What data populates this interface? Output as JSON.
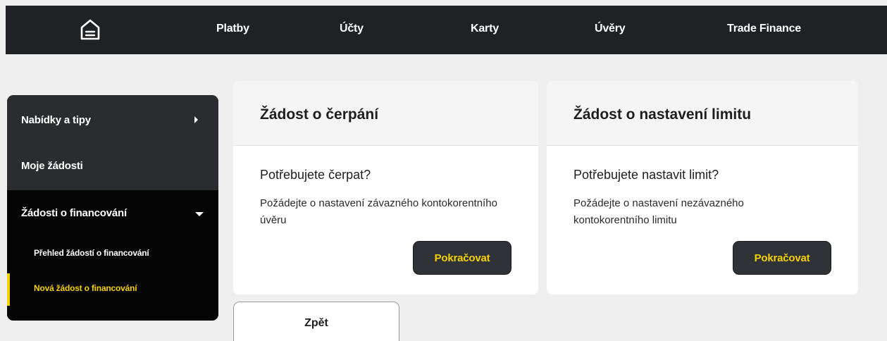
{
  "nav": {
    "home_icon": "home-icon",
    "items": [
      "Platby",
      "Účty",
      "Karty",
      "Úvěry",
      "Trade Finance"
    ]
  },
  "sidebar": {
    "items": [
      {
        "label": "Nabídky a tipy",
        "icon": "chevron-right-icon"
      },
      {
        "label": "Moje žádosti"
      },
      {
        "label": "Žádosti o financování",
        "icon": "chevron-down-icon"
      }
    ],
    "subitems": [
      {
        "label": "Přehled žádostí o financování"
      },
      {
        "label": "Nová žádost o financování",
        "active": true
      }
    ]
  },
  "cards": [
    {
      "title": "Žádost o čerpání",
      "question": "Potřebujete čerpat?",
      "text": "Požádejte o nastavení závazného kontokorentního úvěru",
      "button": "Pokračovat"
    },
    {
      "title": "Žádost o nastavení limitu",
      "question": "Potřebujete nastavit limit?",
      "text": "Požádejte o nastavení nezávazného kontokorentního limitu",
      "button": "Pokračovat"
    }
  ],
  "back_button": "Zpět",
  "colors": {
    "topbar": "#202124",
    "sidebar": "#2a2c30",
    "accent": "#f5d100",
    "background": "#efefef"
  }
}
